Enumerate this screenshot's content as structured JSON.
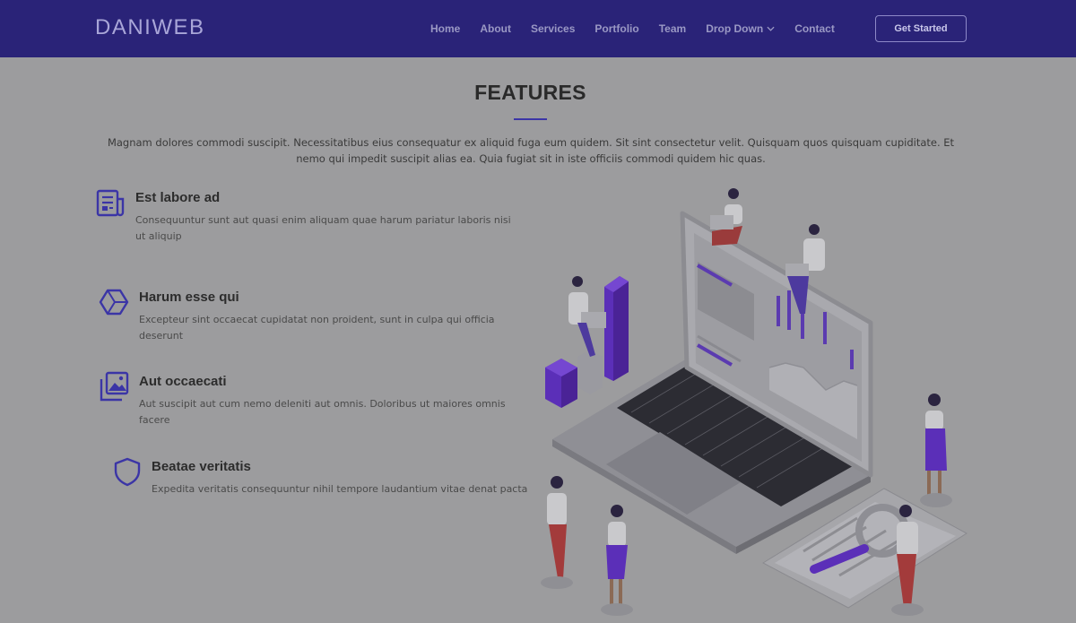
{
  "brand": {
    "logo": "DANIWEB"
  },
  "nav": {
    "items": [
      "Home",
      "About",
      "Services",
      "Portfolio",
      "Team",
      "Drop Down",
      "Contact"
    ],
    "cta": "Get Started"
  },
  "features_section": {
    "title": "FEATURES",
    "lead": "Magnam dolores commodi suscipit. Necessitatibus eius consequatur ex aliquid fuga eum quidem. Sit sint consectetur velit. Quisquam quos quisquam cupiditate. Et nemo qui impedit suscipit alias ea. Quia fugiat sit in iste officiis commodi quidem hic quas.",
    "items": [
      {
        "icon": "newspaper-icon",
        "title": "Est labore ad",
        "text": "Consequuntur sunt aut quasi enim aliquam quae harum pariatur laboris nisi ut aliquip"
      },
      {
        "icon": "hexagon-box-icon",
        "title": "Harum esse qui",
        "text": "Excepteur sint occaecat cupidatat non proident, sunt in culpa qui officia deserunt"
      },
      {
        "icon": "images-icon",
        "title": "Aut occaecati",
        "text": "Aut suscipit aut cum nemo deleniti aut omnis. Doloribus ut maiores omnis facere"
      },
      {
        "icon": "shield-icon",
        "title": "Beatae veritatis",
        "text": "Expedita veritatis consequuntur nihil tempore laudantium vitae denat pacta"
      }
    ]
  },
  "colors": {
    "header": "#2a2378",
    "accent": "#3b35a6",
    "overlay_bg": "#9c9c9e"
  }
}
